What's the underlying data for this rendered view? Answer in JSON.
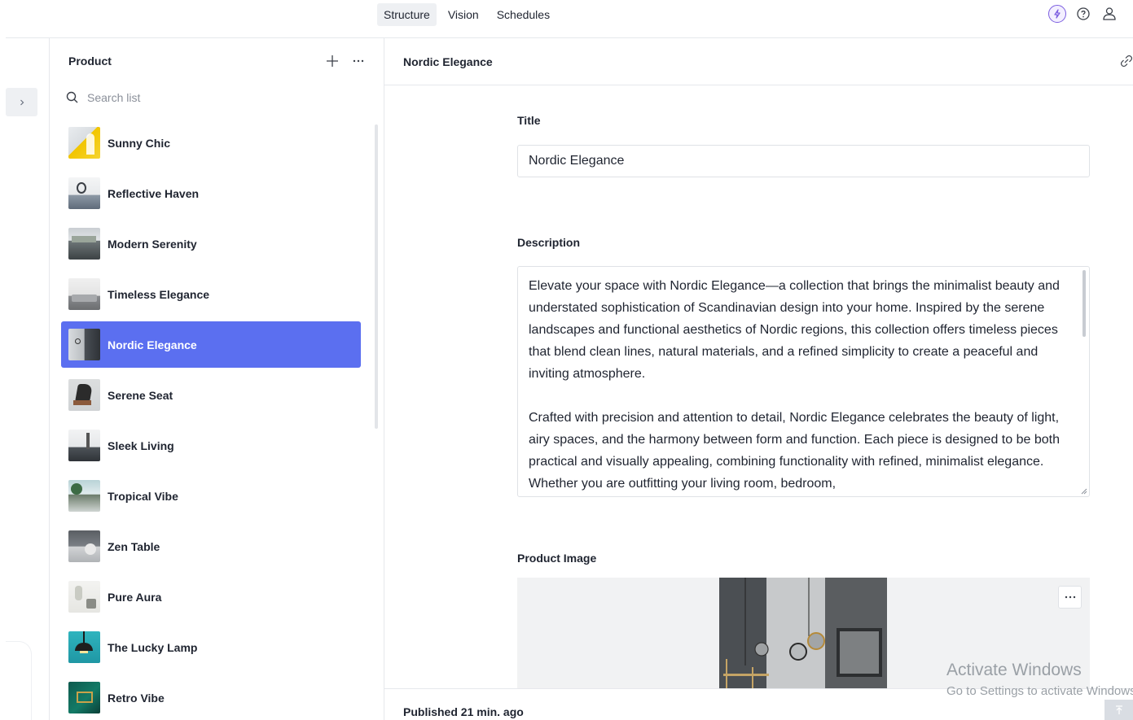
{
  "top_nav": {
    "tabs": [
      {
        "label": "Structure",
        "active": true
      },
      {
        "label": "Vision",
        "active": false
      },
      {
        "label": "Schedules",
        "active": false
      }
    ],
    "icons": [
      "bolt-icon",
      "help-icon",
      "user-icon"
    ]
  },
  "list": {
    "header": "Product",
    "add_icon": "plus-icon",
    "menu_icon": "ellipsis-icon",
    "search_placeholder": "Search list",
    "items": [
      {
        "label": "Sunny Chic",
        "selected": false
      },
      {
        "label": "Reflective Haven",
        "selected": false
      },
      {
        "label": "Modern Serenity",
        "selected": false
      },
      {
        "label": "Timeless Elegance",
        "selected": false
      },
      {
        "label": "Nordic Elegance",
        "selected": true
      },
      {
        "label": "Serene Seat",
        "selected": false
      },
      {
        "label": "Sleek Living",
        "selected": false
      },
      {
        "label": "Tropical Vibe",
        "selected": false
      },
      {
        "label": "Zen Table",
        "selected": false
      },
      {
        "label": "Pure Aura",
        "selected": false
      },
      {
        "label": "The Lucky Lamp",
        "selected": false
      },
      {
        "label": "Retro Vibe",
        "selected": false
      }
    ]
  },
  "document": {
    "header_title": "Nordic Elegance",
    "title_label": "Title",
    "title_value": "Nordic Elegance",
    "description_label": "Description",
    "description_paragraphs": [
      "Elevate your space with Nordic Elegance—a collection that brings the minimalist beauty and understated sophistication of Scandinavian design into your home. Inspired by the serene landscapes and functional aesthetics of Nordic regions, this collection offers timeless pieces that blend clean lines, natural materials, and a refined simplicity to create a peaceful and inviting atmosphere.",
      "Crafted with precision and attention to detail, Nordic Elegance celebrates the beauty of light, airy spaces, and the harmony between form and function. Each piece is designed to be both practical and visually appealing, combining functionality with refined, minimalist elegance. Whether you are outfitting your living room, bedroom,"
    ],
    "image_label": "Product Image",
    "status": "Published 21 min. ago"
  },
  "watermark": {
    "title": "Activate Windows",
    "subtitle": "Go to Settings to activate Windows."
  },
  "colors": {
    "accent": "#5b6ff0",
    "bolt": "#7b5de0",
    "border": "#dfe2e6"
  }
}
